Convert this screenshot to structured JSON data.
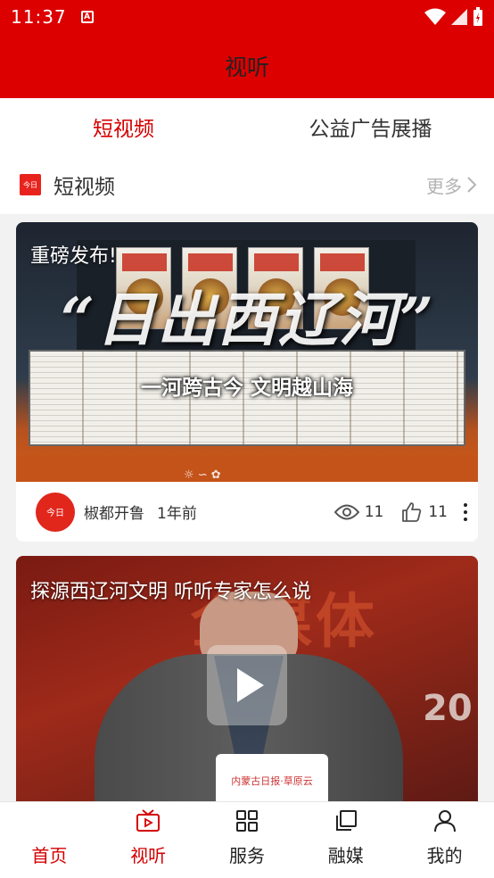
{
  "status_bar": {
    "time": "11:37",
    "app_icon_letter": "A"
  },
  "header": {
    "title": "视听"
  },
  "tabs": [
    {
      "label": "短视频",
      "active": true
    },
    {
      "label": "公益广告展播",
      "active": false
    }
  ],
  "section": {
    "title": "短视频",
    "more_label": "更多",
    "logo_text": "今日"
  },
  "videos": [
    {
      "title": "重磅发布!",
      "image_calligraphy": "“日出西辽河”",
      "image_slogan": "一河跨古今 文明越山海",
      "avatar_text": "今日",
      "author": "椒都开鲁",
      "time": "1年前",
      "views": "11",
      "likes": "11"
    },
    {
      "title": "探源西辽河文明  听听专家怎么说",
      "image_bg_text": "全媒体",
      "image_year": "20",
      "mic_card_text": "内蒙古日报·草原云"
    }
  ],
  "bottom_nav": [
    {
      "label": "首页",
      "icon": "home-icon",
      "active": false
    },
    {
      "label": "视听",
      "icon": "video-icon",
      "active": true
    },
    {
      "label": "服务",
      "icon": "grid-icon",
      "active": false
    },
    {
      "label": "融媒",
      "icon": "stack-icon",
      "active": false
    },
    {
      "label": "我的",
      "icon": "person-icon",
      "active": false
    }
  ],
  "colors": {
    "brand_red": "#dc0000",
    "active_text": "#d40000",
    "muted": "#b3b3b3"
  }
}
